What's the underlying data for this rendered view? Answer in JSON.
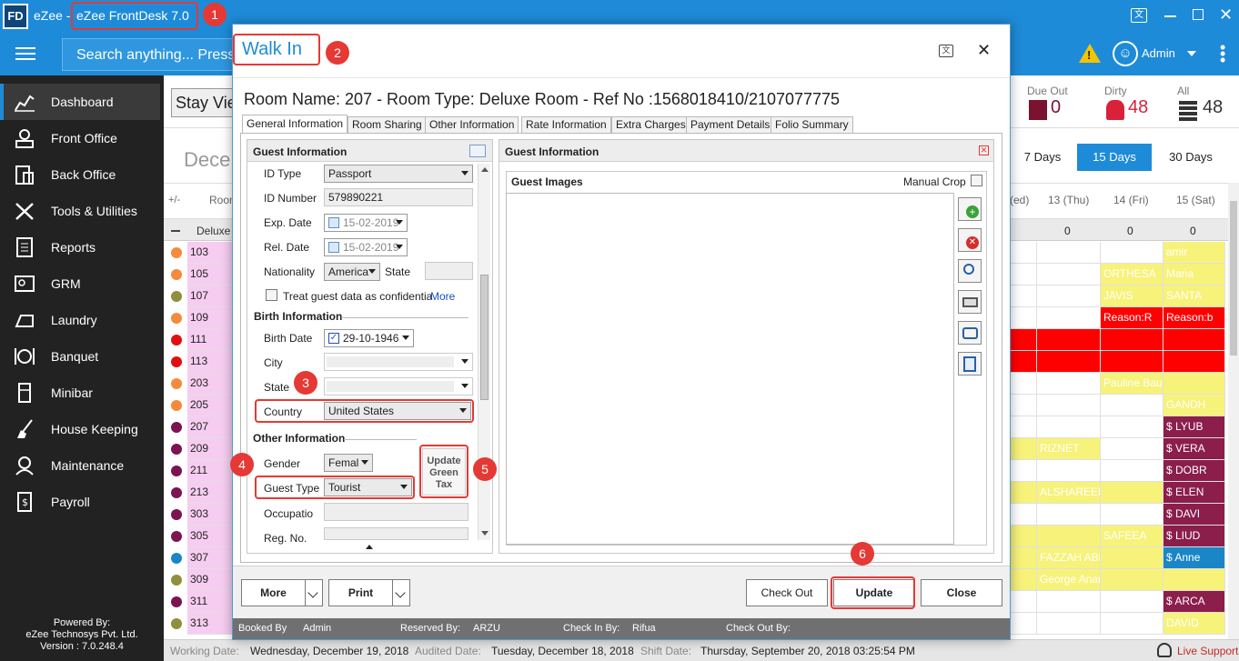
{
  "titlebar": {
    "logo": "FD",
    "app_prefix": "eZee -",
    "title": "eZee FrontDesk 7.0"
  },
  "appbar": {
    "search_placeholder": "Search anything... Press",
    "user": "Admin"
  },
  "sidebar": {
    "items": [
      {
        "label": "Dashboard"
      },
      {
        "label": "Front Office"
      },
      {
        "label": "Back Office"
      },
      {
        "label": "Tools & Utilities"
      },
      {
        "label": "Reports"
      },
      {
        "label": "GRM"
      },
      {
        "label": "Laundry"
      },
      {
        "label": "Banquet"
      },
      {
        "label": "Minibar"
      },
      {
        "label": "House Keeping"
      },
      {
        "label": "Maintenance"
      },
      {
        "label": "Payroll"
      }
    ],
    "powered_by": "Powered By:",
    "company": "eZee Technosys Pvt. Ltd.",
    "version": "Version : 7.0.248.4"
  },
  "main": {
    "stay_view": "Stay Vie",
    "month": "Dece",
    "stats": [
      {
        "label": "Due Out",
        "value": "0"
      },
      {
        "label": "Dirty",
        "value": "48"
      },
      {
        "label": "All",
        "value": "48"
      }
    ],
    "range_buttons": [
      "7 Days",
      "15 Days",
      "30 Days"
    ],
    "grid_header": {
      "plusminus": "+/-",
      "room": "Room",
      "cols": [
        "(ed)",
        "13 (Thu)",
        "14 (Fri)",
        "15 (Sat)"
      ]
    },
    "group": {
      "label": "Deluxe",
      "counts": [
        "0",
        "0",
        "0"
      ]
    },
    "rooms": [
      "103",
      "105",
      "107",
      "109",
      "111",
      "113",
      "203",
      "205",
      "207",
      "209",
      "211",
      "213",
      "303",
      "305",
      "307",
      "309",
      "311",
      "313"
    ],
    "bookings": {
      "r103": "amir",
      "r105a": "ORTHESA",
      "r105b": "Maria",
      "r107a": "JAVIS",
      "r107b": "SANTA",
      "r109a": "Reason:R",
      "r109b": "Reason:b",
      "r203": "Pauline Bauraire",
      "r205": "GANDH",
      "r207": "LYUB",
      "r209a": "RIZNET",
      "r209b": "VERA",
      "r211": "DOBR",
      "r213a": "ALSHAREEFA",
      "r213b": "ELEN",
      "r303": "DAVI",
      "r305a": "SAFEEA",
      "r305b": "LIUD",
      "r307a": "FAZZAH ABDUL",
      "r307b": "Anne",
      "r309": "George Anand",
      "r311": "ARCA",
      "r313": "DAVID"
    }
  },
  "statusbar": {
    "working_label": "Working Date:",
    "working_value": "Wednesday, December 19, 2018",
    "audited_label": "Audited Date:",
    "audited_value": "Tuesday, December 18, 2018",
    "shift_label": "Shift Date:",
    "shift_value": "Thursday, September 20, 2018 03:25:54 PM",
    "live_support": "Live Support"
  },
  "dialog": {
    "title": "Walk In",
    "heading": "Room Name: 207 - Room Type: Deluxe Room - Ref No :1568018410/2107077775",
    "tabs": [
      "General Information",
      "Room Sharing",
      "Other Information",
      "Rate Information",
      "Extra Charges",
      "Payment Details",
      "Folio Summary"
    ],
    "left": {
      "guest_info_title": "Guest Information",
      "id_type_label": "ID Type",
      "id_type_value": "Passport",
      "id_number_label": "ID Number",
      "id_number_value": "579890221",
      "exp_label": "Exp. Date",
      "exp_value": "15-02-2019",
      "rel_label": "Rel. Date",
      "rel_value": "15-02-2019",
      "nationality_label": "Nationality",
      "nationality_value": "America",
      "state_label": "State",
      "confidential_label": "Treat guest data as confidentia",
      "more_link": "More",
      "birth_title": "Birth Information",
      "birth_label": "Birth Date",
      "birth_value": "29-10-1946",
      "city_label": "City",
      "state2_label": "State",
      "country_label": "Country",
      "country_value": "United States",
      "other_title": "Other Information",
      "gender_label": "Gender",
      "gender_value": "Femal",
      "guest_type_label": "Guest Type",
      "guest_type_value": "Tourist",
      "update_tax_l1": "Update",
      "update_tax_l2": "Green",
      "update_tax_l3": "Tax",
      "occupation_label": "Occupatio",
      "reg_label": "Reg. No."
    },
    "right": {
      "title": "Guest Information",
      "images_title": "Guest Images",
      "manual_crop": "Manual Crop"
    },
    "buttons": {
      "more": "More",
      "print": "Print",
      "check_out": "Check Out",
      "update": "Update",
      "close": "Close"
    },
    "footer": {
      "booked_label": "Booked By",
      "booked_value": "Admin",
      "reserved_label": "Reserved By:",
      "reserved_value": "ARZU",
      "checkin_label": "Check In By:",
      "checkin_value": "Rifua",
      "checkout_label": "Check Out By:"
    }
  },
  "annotations": [
    "1",
    "2",
    "3",
    "4",
    "5",
    "6"
  ],
  "colors": {
    "accent": "#1e8bd8",
    "sidebar": "#222222",
    "highlight": "#e53935",
    "booking_yellow": "#f7f27a",
    "booking_red": "#ff0000",
    "checked_in": "#8b1e4b"
  }
}
